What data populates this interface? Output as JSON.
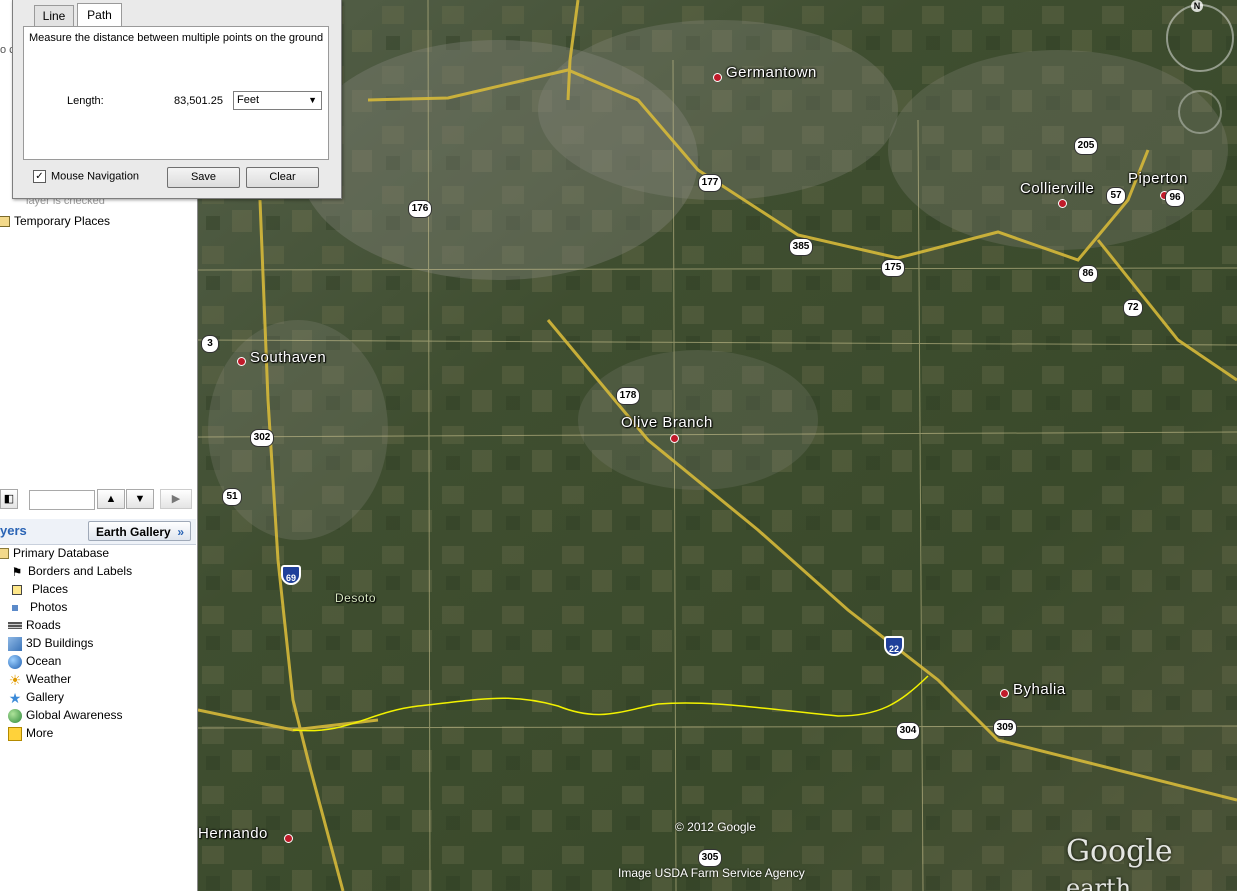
{
  "sidebar": {
    "clip_text_1": "o c",
    "layer_checked_text": "layer is checked",
    "temporary_places": "Temporary Places",
    "layers_title": "yers",
    "earth_gallery_label": "Earth Gallery",
    "earth_gallery_chevron": "»",
    "layers": [
      {
        "label": "Primary Database",
        "icon": "folder-icon"
      },
      {
        "label": "Borders and Labels",
        "icon": "borders-icon"
      },
      {
        "label": "Places",
        "icon": "places-icon"
      },
      {
        "label": "Photos",
        "icon": "photos-icon"
      },
      {
        "label": "Roads",
        "icon": "roads-icon"
      },
      {
        "label": "3D Buildings",
        "icon": "buildings-icon"
      },
      {
        "label": "Ocean",
        "icon": "ocean-icon"
      },
      {
        "label": "Weather",
        "icon": "weather-icon"
      },
      {
        "label": "Gallery",
        "icon": "gallery-icon"
      },
      {
        "label": "Global Awareness",
        "icon": "globe-icon"
      },
      {
        "label": "More",
        "icon": "more-icon"
      }
    ]
  },
  "ruler": {
    "tabs": [
      "Line",
      "Path"
    ],
    "active_tab": "Path",
    "description": "Measure the distance between multiple points on the ground",
    "length_label": "Length:",
    "length_value": "83,501.25",
    "unit": "Feet",
    "mouse_navigation_label": "Mouse Navigation",
    "mouse_navigation_checked": true,
    "save_label": "Save",
    "clear_label": "Clear"
  },
  "map": {
    "places": {
      "germantown": "Germantown",
      "collierville": "Collierville",
      "piperton": "Piperton",
      "southaven": "Southaven",
      "olive_branch": "Olive Branch",
      "desoto": "Desoto",
      "byhalia": "Byhalia",
      "hernando": "Hernando"
    },
    "routes": {
      "r176": "176",
      "r177": "177",
      "r385": "385",
      "r175": "175",
      "r205": "205",
      "r57": "57",
      "r96": "96",
      "r86": "86",
      "r72": "72",
      "r3": "3",
      "r178": "178",
      "r302": "302",
      "r51": "51",
      "r304": "304",
      "r309": "309",
      "r305": "305"
    },
    "interstates": {
      "i69": "69",
      "i22": "22"
    },
    "compass_n": "N",
    "copyright": "© 2012 Google",
    "imagery": "Image USDA Farm Service Agency",
    "logo_main": "Google",
    "logo_sub": "earth",
    "path_color": "#f2f200"
  }
}
